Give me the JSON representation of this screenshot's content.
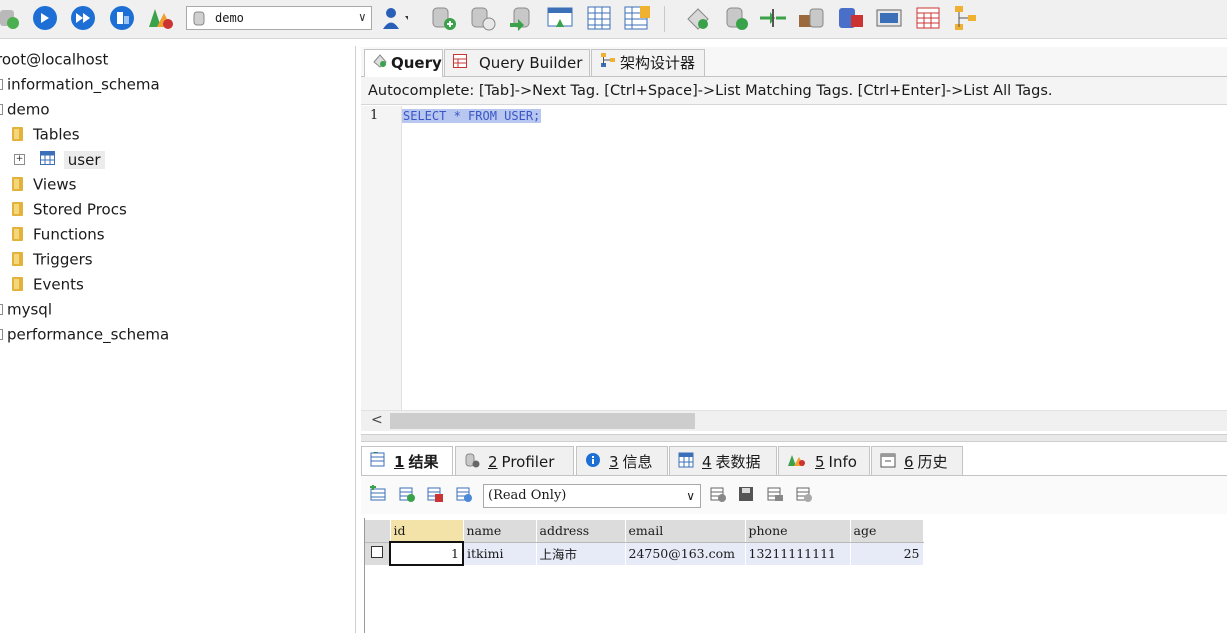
{
  "toolbar": {
    "db_selector": {
      "value": "demo"
    },
    "icons": [
      "connect-icon",
      "refresh-icon",
      "execute-icon",
      "execute-all-icon",
      "restore-icon",
      "schema-tools-icon",
      "user-manager-icon",
      "new-database-icon",
      "drop-database-icon",
      "backup-icon",
      "import-icon",
      "table-grid-icon",
      "table-designer-icon",
      "sql-tool-icon",
      "data-sync-icon",
      "schema-sync-icon",
      "data-transfer-icon",
      "query-builder-icon",
      "calendar-icon",
      "hierarchy-icon"
    ]
  },
  "tree": {
    "root": "root@localhost",
    "databases": [
      "information_schema",
      "demo",
      "mysql",
      "performance_schema"
    ],
    "demo_children": [
      "Tables",
      "Views",
      "Stored Procs",
      "Functions",
      "Triggers",
      "Events"
    ],
    "tables": [
      "user"
    ]
  },
  "editor": {
    "tabs": [
      {
        "label": "Query",
        "active": true
      },
      {
        "label": "Query Builder",
        "active": false
      },
      {
        "label": "架构设计器",
        "active": false
      }
    ],
    "autocomplete_hint": "Autocomplete: [Tab]->Next Tag. [Ctrl+Space]->List Matching Tags. [Ctrl+Enter]->List All Tags.",
    "line_number": "1",
    "sql": "SELECT * FROM USER;"
  },
  "result": {
    "tabs": [
      {
        "num": "1",
        "label": "结果",
        "active": true
      },
      {
        "num": "2",
        "label": "Profiler",
        "active": false
      },
      {
        "num": "3",
        "label": "信息",
        "active": false
      },
      {
        "num": "4",
        "label": "表数据",
        "active": false
      },
      {
        "num": "5",
        "label": "Info",
        "active": false
      },
      {
        "num": "6",
        "label": "历史",
        "active": false
      }
    ],
    "mode_select": {
      "value": "(Read Only)"
    },
    "columns": [
      "id",
      "name",
      "address",
      "email",
      "phone",
      "age"
    ],
    "rows": [
      [
        "1",
        "itkimi",
        "上海市",
        "24750@163.com",
        "13211111111",
        "25"
      ]
    ]
  },
  "colors": {
    "selection_highlight": "#b7c7ef",
    "sql_text": "#3a55c8",
    "grid_row": "#e6ebf7",
    "grid_header_active": "#f3e3a8",
    "folder": "#e3b23c"
  }
}
